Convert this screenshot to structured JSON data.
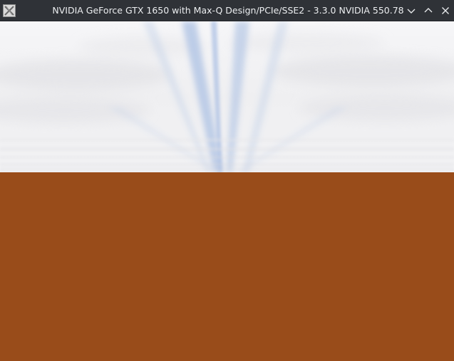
{
  "window": {
    "title": "NVIDIA GeForce GTX 1650 with Max-Q Design/PCIe/SSE2 - 3.3.0 NVIDIA 550.78",
    "icon": "x11-app-icon",
    "controls": {
      "minimize_icon": "chevron-down-icon",
      "maximize_icon": "chevron-up-icon",
      "close_icon": "close-icon"
    }
  },
  "scene": {
    "sky_color": "#f3f4f6",
    "sky_tint": "#b8c9e6",
    "ground_color": "#994c1a"
  }
}
